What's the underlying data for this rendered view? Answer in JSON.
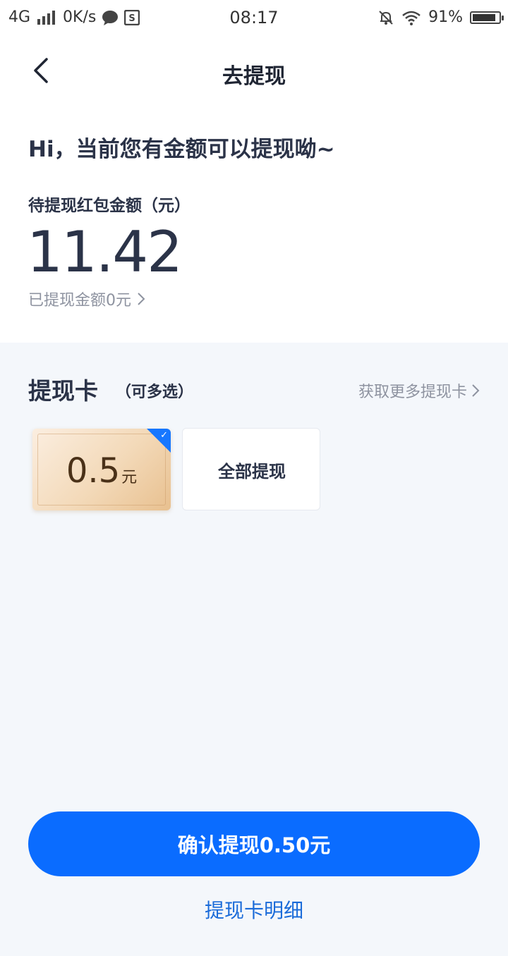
{
  "status_bar": {
    "network": "4G",
    "speed": "0K/s",
    "time": "08:17",
    "battery": "91%",
    "battery_level": 0.91
  },
  "nav": {
    "title": "去提现"
  },
  "greeting": "Hi，当前您有金额可以提现呦~",
  "balance": {
    "label": "待提现红包金额（元）",
    "amount": "11.42",
    "withdrawn": "已提现金额0元"
  },
  "cards_section": {
    "title": "提现卡",
    "subtitle": "（可多选）",
    "more_link": "获取更多提现卡",
    "cards": [
      {
        "value": "0.5",
        "unit": "元",
        "selected": true
      },
      {
        "label": "全部提现",
        "selected": false
      }
    ]
  },
  "actions": {
    "confirm": "确认提现0.50元",
    "detail_link": "提现卡明细"
  },
  "colors": {
    "primary": "#0a6cff",
    "text_dark": "#2b3348",
    "text_muted": "#8e93a0",
    "section_bg": "#f4f7fb",
    "link": "#1a6bd9"
  }
}
